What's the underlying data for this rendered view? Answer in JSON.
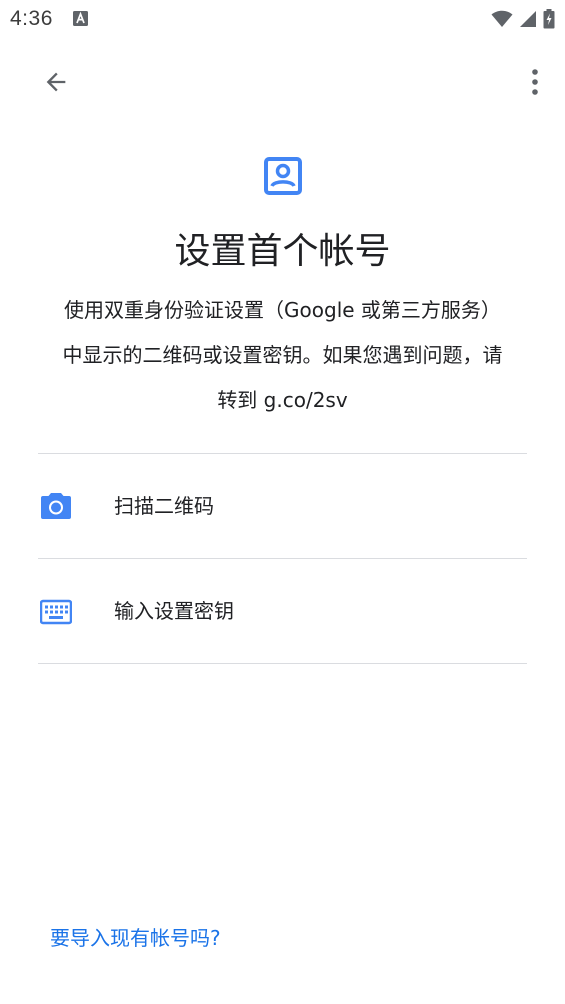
{
  "status_bar": {
    "time": "4:36",
    "icons": [
      "text-recognition-icon",
      "wifi-icon",
      "cell-signal-icon",
      "battery-charging-icon"
    ]
  },
  "app_bar": {
    "back_icon": "arrow-back-icon",
    "more_icon": "more-vert-icon"
  },
  "header": {
    "icon": "account-box-icon",
    "title": "设置首个帐号",
    "description_lines": [
      "使用双重身份验证设置（Google 或第三方服务）",
      "中显示的二维码或设置密钥。如果您遇到问题，请",
      "转到 g.co/2sv"
    ]
  },
  "options": [
    {
      "icon": "camera-icon",
      "label": "扫描二维码"
    },
    {
      "icon": "keyboard-icon",
      "label": "输入设置密钥"
    }
  ],
  "footer": {
    "import_link": "要导入现有帐号吗?"
  },
  "colors": {
    "accent": "#1a73e8",
    "icon_blue": "#4285f4",
    "divider": "#dadce0",
    "text_primary": "#202124",
    "status_icon": "#5f6368"
  }
}
